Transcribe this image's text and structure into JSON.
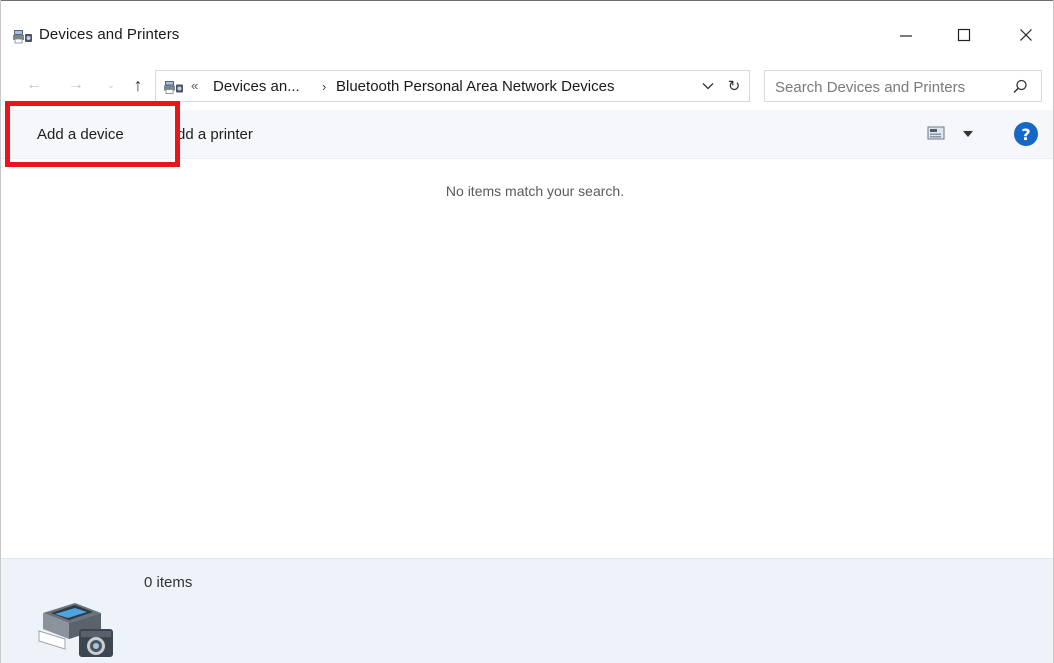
{
  "window": {
    "title": "Devices and Printers",
    "icon": "devices-printers-icon"
  },
  "title_controls": {
    "minimize": "minimize-icon",
    "maximize": "maximize-icon",
    "close": "close-icon"
  },
  "navigation": {
    "back": "←",
    "forward": "→",
    "recent": "⌄",
    "up": "↑"
  },
  "address": {
    "overflow_glyph": "«",
    "segments": [
      "Devices an...",
      "Bluetooth Personal Area Network Devices"
    ],
    "separator": "›",
    "refresh": "↻"
  },
  "search": {
    "placeholder": "Search Devices and Printers",
    "value": ""
  },
  "toolbar": {
    "add_device_label": "Add a device",
    "add_printer_label": "dd a printer",
    "view_options_icon": "change-view-icon",
    "help_icon": "?"
  },
  "content": {
    "empty_message": "No items match your search."
  },
  "details": {
    "item_count": "0 items",
    "icon": "devices-printers-large-icon"
  },
  "colors": {
    "highlight_box": "#e8151b",
    "command_bar_bg": "#f5f7fa",
    "details_bg": "#eef3f9",
    "help_blue": "#1667c6"
  }
}
